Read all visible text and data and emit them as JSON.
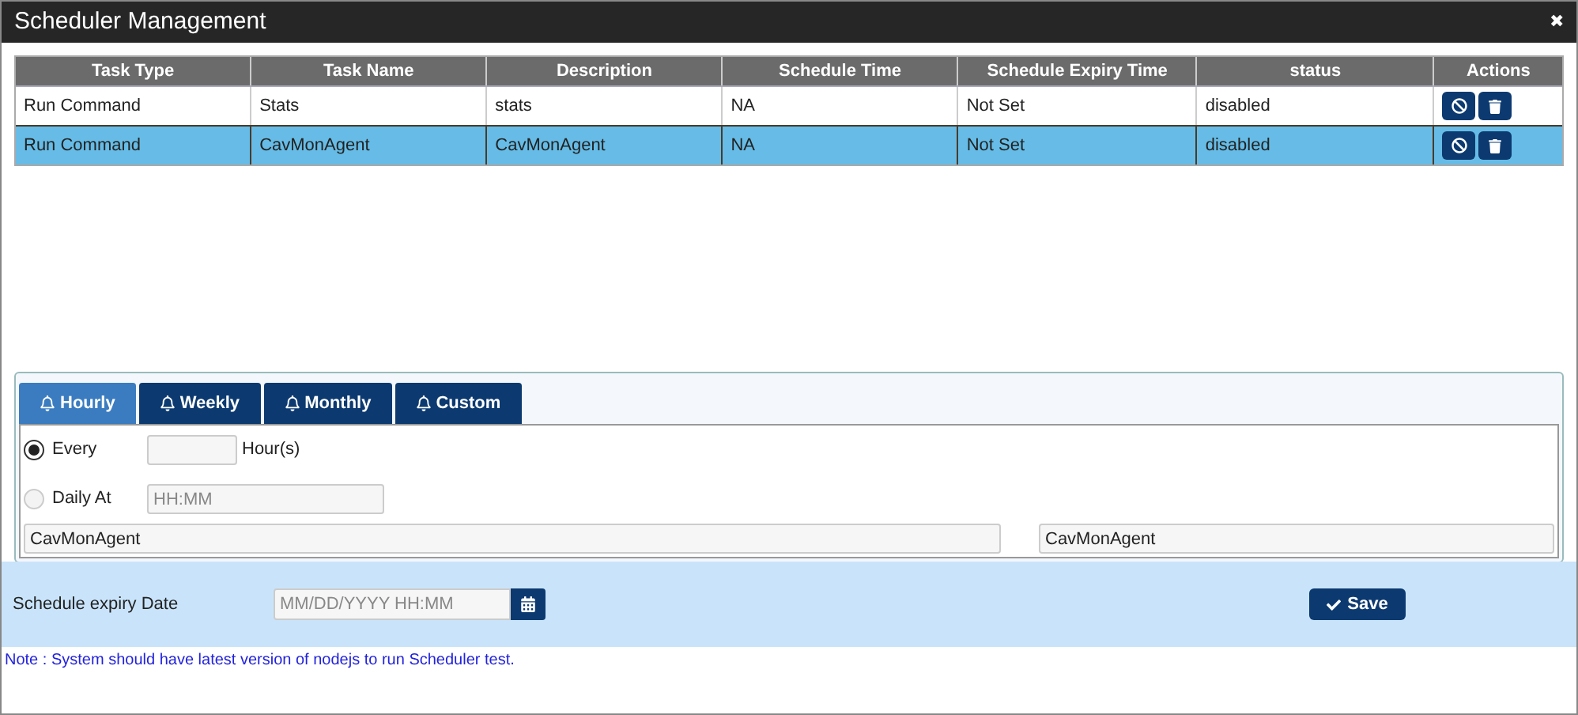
{
  "window": {
    "title": "Scheduler Management",
    "close": "✖"
  },
  "table": {
    "columns": [
      "Task Type",
      "Task Name",
      "Description",
      "Schedule Time",
      "Schedule Expiry Time",
      "status",
      "Actions"
    ],
    "rows": [
      {
        "selected": false,
        "cells": [
          "Run Command",
          "Stats",
          "stats",
          "NA",
          "Not Set",
          "disabled"
        ]
      },
      {
        "selected": true,
        "cells": [
          "Run Command",
          "CavMonAgent",
          "CavMonAgent",
          "NA",
          "Not Set",
          "disabled"
        ]
      }
    ]
  },
  "tabs": [
    {
      "label": "Hourly",
      "selected": true
    },
    {
      "label": "Weekly",
      "selected": false
    },
    {
      "label": "Monthly",
      "selected": false
    },
    {
      "label": "Custom",
      "selected": false
    }
  ],
  "schedule": {
    "options": [
      {
        "kind": "hours",
        "label": "Every",
        "selected": true,
        "unit": "Hour(s)"
      },
      {
        "kind": "time",
        "label": "Daily At",
        "selected": false,
        "placeholder": "HH:MM"
      }
    ],
    "info_fields": [
      "CavMonAgent",
      "CavMonAgent"
    ]
  },
  "expiry": {
    "label": "Schedule expiry Date",
    "placeholder": "MM/DD/YYYY HH:MM"
  },
  "save_button": "Save",
  "note": "Note : System should have latest version of nodejs to run Scheduler test."
}
